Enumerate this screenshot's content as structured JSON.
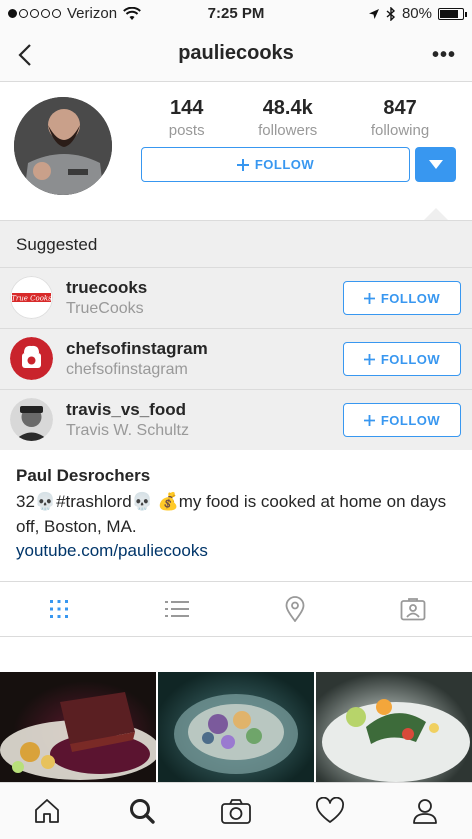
{
  "status_bar": {
    "carrier": "Verizon",
    "time": "7:25 PM",
    "battery": "80%",
    "battery_level": 0.8,
    "signal_dots_filled": 1,
    "signal_dots_total": 5
  },
  "nav": {
    "title": "pauliecooks",
    "back_icon": "chevron-left-icon",
    "more_icon": "ellipsis-icon",
    "more_label": "•••"
  },
  "profile": {
    "stats": [
      {
        "value": "144",
        "label": "posts"
      },
      {
        "value": "48.4k",
        "label": "followers"
      },
      {
        "value": "847",
        "label": "following"
      }
    ],
    "follow_label": "FOLLOW",
    "accent_color": "#3897f0"
  },
  "suggested": {
    "title": "Suggested",
    "accounts": [
      {
        "username": "truecooks",
        "name": "TrueCooks",
        "follow_label": "FOLLOW"
      },
      {
        "username": "chefsofinstagram",
        "name": "chefsofinstagram",
        "follow_label": "FOLLOW"
      },
      {
        "username": "travis_vs_food",
        "name": "Travis W. Schultz",
        "follow_label": "FOLLOW"
      }
    ]
  },
  "bio": {
    "name": "Paul Desrochers",
    "text": "32💀#trashlord💀 💰my food is cooked at home on days off, Boston, MA.",
    "link": "youtube.com/pauliecooks"
  },
  "view_tabs": [
    "grid-icon",
    "list-icon",
    "location-pin-icon",
    "tagged-icon"
  ],
  "bottom_tabs": [
    "home-icon",
    "search-icon",
    "camera-icon",
    "heart-icon",
    "profile-icon"
  ]
}
